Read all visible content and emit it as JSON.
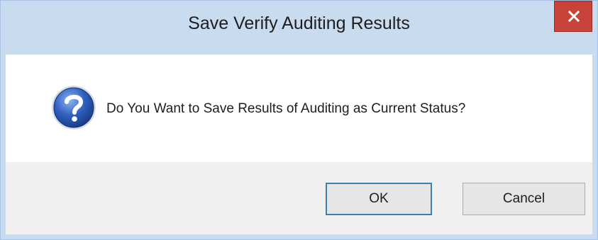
{
  "dialog": {
    "title": "Save Verify Auditing Results",
    "message": "Do You Want to Save Results of Auditing as Current Status?",
    "icon": "question-icon",
    "buttons": {
      "ok_label": "OK",
      "cancel_label": "Cancel"
    },
    "close_icon": "close-icon"
  },
  "colors": {
    "titlebar": "#c9dbef",
    "close_button": "#c8433a",
    "client_background": "#f0f0f0",
    "message_background": "#ffffff",
    "default_button_border": "#3c7fb1"
  }
}
